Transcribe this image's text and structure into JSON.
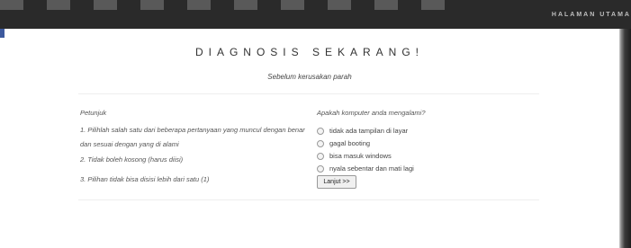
{
  "nav": {
    "home_link": "HALAMAN UTAMA"
  },
  "page": {
    "title": "DIAGNOSIS SEKARANG!",
    "subtitle": "Sebelum kerusakan parah"
  },
  "instructions": {
    "heading": "Petunjuk",
    "items": [
      "1. Pilihlah salah satu dari beberapa pertanyaan yang muncul dengan benar dan sesuai dengan yang di alami",
      "2. Tidak boleh kosong (harus diisi)",
      "3. Pilihan tidak bisa disisi lebih dari satu (1)"
    ]
  },
  "question": {
    "heading": "Apakah komputer anda mengalami?",
    "options": [
      "tidak ada tampilan di layar",
      "gagal booting",
      "bisa masuk windows",
      "nyala sebentar dan mati lagi"
    ],
    "submit_label": "Lanjut >>"
  }
}
